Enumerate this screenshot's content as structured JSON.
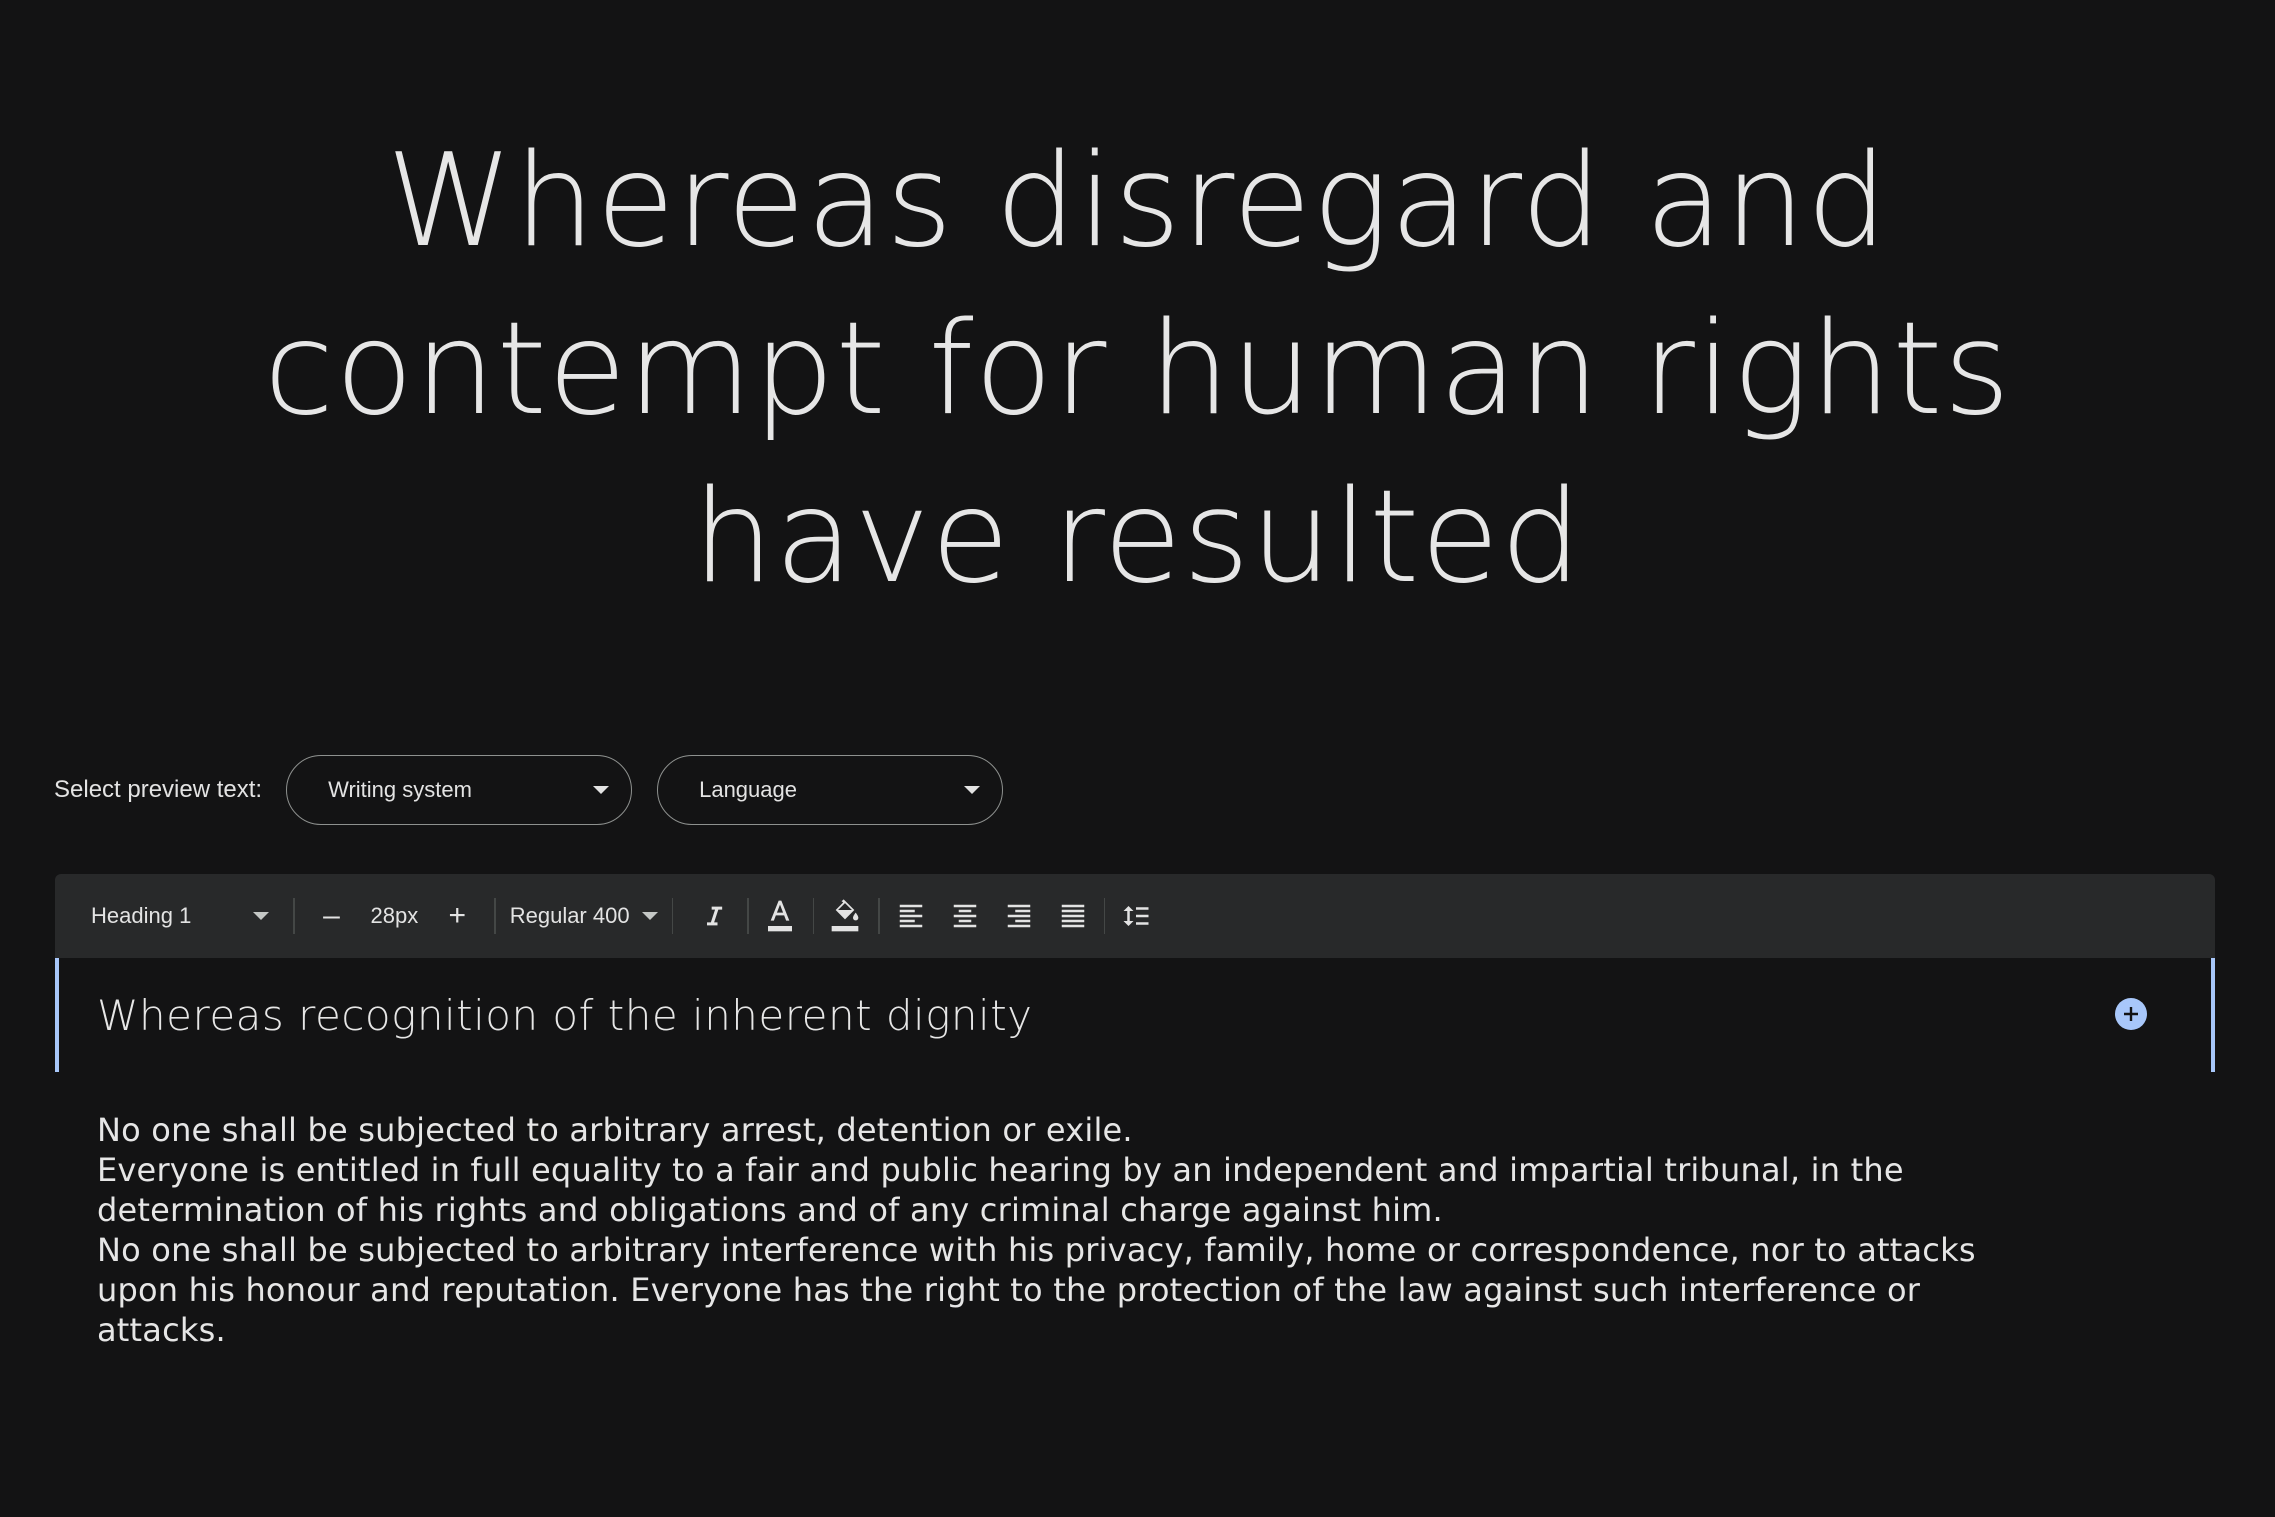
{
  "hero": {
    "lines": [
      "Whereas disregard and",
      "contempt for human rights",
      "have resulted"
    ]
  },
  "preview": {
    "label": "Select preview text:",
    "writing_system": "Writing system",
    "language": "Language"
  },
  "toolbar": {
    "style": "Heading 1",
    "decrease": "–",
    "size": "28px",
    "increase": "+",
    "weight": "Regular 400",
    "icons": [
      "italic-icon",
      "text-color-icon",
      "highlight-color-icon",
      "align-left-icon",
      "align-center-icon",
      "align-right-icon",
      "align-justify-icon",
      "line-height-icon"
    ]
  },
  "editor": {
    "heading": "Whereas recognition of the inherent dignity",
    "body_lines": [
      "No one shall be subjected to arbitrary arrest, detention or exile.",
      "Everyone is entitled in full equality to a fair and public hearing by an independent and impartial tribunal, in the",
      "determination of his rights and obligations and of any criminal charge against him.",
      "No one shall be subjected to arbitrary interference with his privacy, family, home or correspondence, nor to attacks",
      "upon his honour and reputation. Everyone has the right to the protection of the law against such interference or",
      "attacks."
    ]
  },
  "colors": {
    "background": "#131314",
    "toolbar": "#28292a",
    "accent": "#a8c7fa",
    "text": "#e3e3e3"
  }
}
